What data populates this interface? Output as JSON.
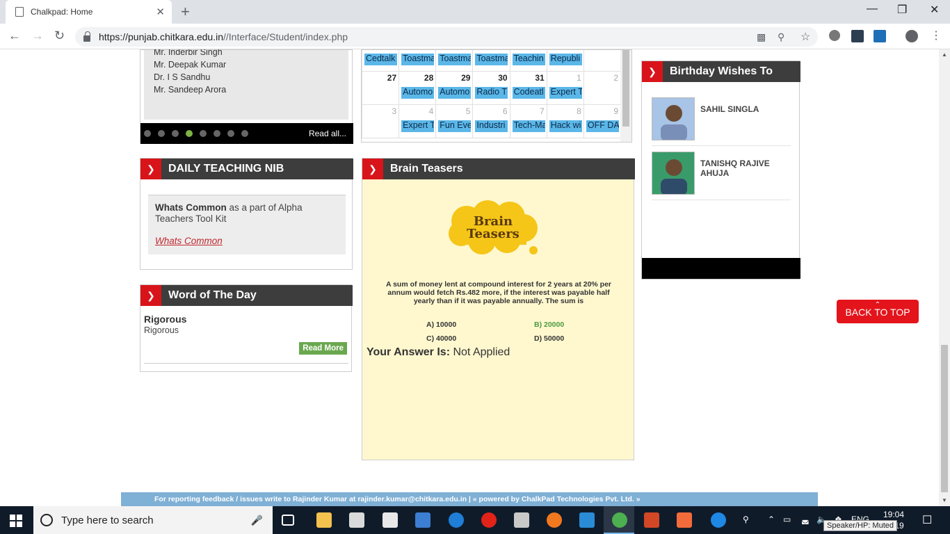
{
  "browser": {
    "tab_title": "Chalkpad: Home",
    "tab_close": "✕",
    "new_tab": "+",
    "url_host": "https://punjab.chitkara.edu.in",
    "url_path": "//Interface/Student/index.php",
    "win_minimize": "—",
    "win_maximize": "❐",
    "win_close": "✕"
  },
  "slider": {
    "names": [
      "Mr. Inderbir Singh",
      "Mr. Deepak Kumar",
      "Dr. I S Sandhu",
      "Mr. Sandeep Arora"
    ],
    "read_all": "Read all..."
  },
  "calendar": {
    "rows": [
      [
        {
          "day": "",
          "event": "Cedtalk"
        },
        {
          "day": "",
          "event": "Toastma"
        },
        {
          "day": "",
          "event": "Toastma"
        },
        {
          "day": "",
          "event": "Toastma"
        },
        {
          "day": "",
          "event": "Teachin"
        },
        {
          "day": "",
          "event": "Republi"
        },
        {
          "day": "",
          "event": ""
        }
      ],
      [
        {
          "day": "27",
          "event": ""
        },
        {
          "day": "28",
          "event": "Automo"
        },
        {
          "day": "29",
          "event": "Automo"
        },
        {
          "day": "30",
          "event": "Radio T"
        },
        {
          "day": "31",
          "event": "Codeatl"
        },
        {
          "day": "1",
          "event": "Expert T"
        },
        {
          "day": "2",
          "event": ""
        }
      ],
      [
        {
          "day": "3",
          "event": ""
        },
        {
          "day": "4",
          "event": "Expert T"
        },
        {
          "day": "5",
          "event": "Fun Eve"
        },
        {
          "day": "6",
          "event": "Industri"
        },
        {
          "day": "7",
          "event": "Tech-Ma"
        },
        {
          "day": "8",
          "event": "Hack wi"
        },
        {
          "day": "9",
          "event": "OFF DA"
        }
      ]
    ]
  },
  "nib": {
    "header": "DAILY TEACHING NIB",
    "bold": "Whats Common",
    "text": " as a part of Alpha Teachers Tool Kit",
    "link": "Whats Common"
  },
  "word": {
    "header": "Word of The Day",
    "title": "Rigorous",
    "sub": "Rigorous",
    "read_more": "Read More"
  },
  "brain": {
    "header": "Brain Teasers",
    "logo_line1": "Brain",
    "logo_line2": "Teasers",
    "question": "A sum of money lent at compound interest for 2 years at 20% per annum would fetch Rs.482 more, if the interest was payable half yearly than if it was payable annually. The sum is",
    "options": [
      "A) 10000",
      "B) 20000",
      "C) 40000",
      "D) 50000"
    ],
    "correct_color": "#4c9a3f",
    "answer_label": "Your Answer Is:",
    "answer_value": " Not Applied"
  },
  "birthday": {
    "header": "Birthday Wishes To",
    "people": [
      "SAHIL SINGLA",
      "TANISHQ RAJIVE AHUJA"
    ]
  },
  "back_to_top": "BACK TO TOP",
  "footer": "For reporting feedback / issues write to Rajinder Kumar at rajinder.kumar@chitkara.edu.in | « powered by ChalkPad Technologies Pvt. Ltd. »",
  "taskbar": {
    "search_placeholder": "Type here to search",
    "lang": "ENG",
    "time": "19:04",
    "date": "…-19",
    "tooltip": "Speaker/HP: Muted"
  },
  "colors": {
    "accent_red": "#d8141a",
    "header_dark": "#3d3d3d",
    "event_blue": "#5bb7e8",
    "footer_blue": "#7fb0d5"
  }
}
